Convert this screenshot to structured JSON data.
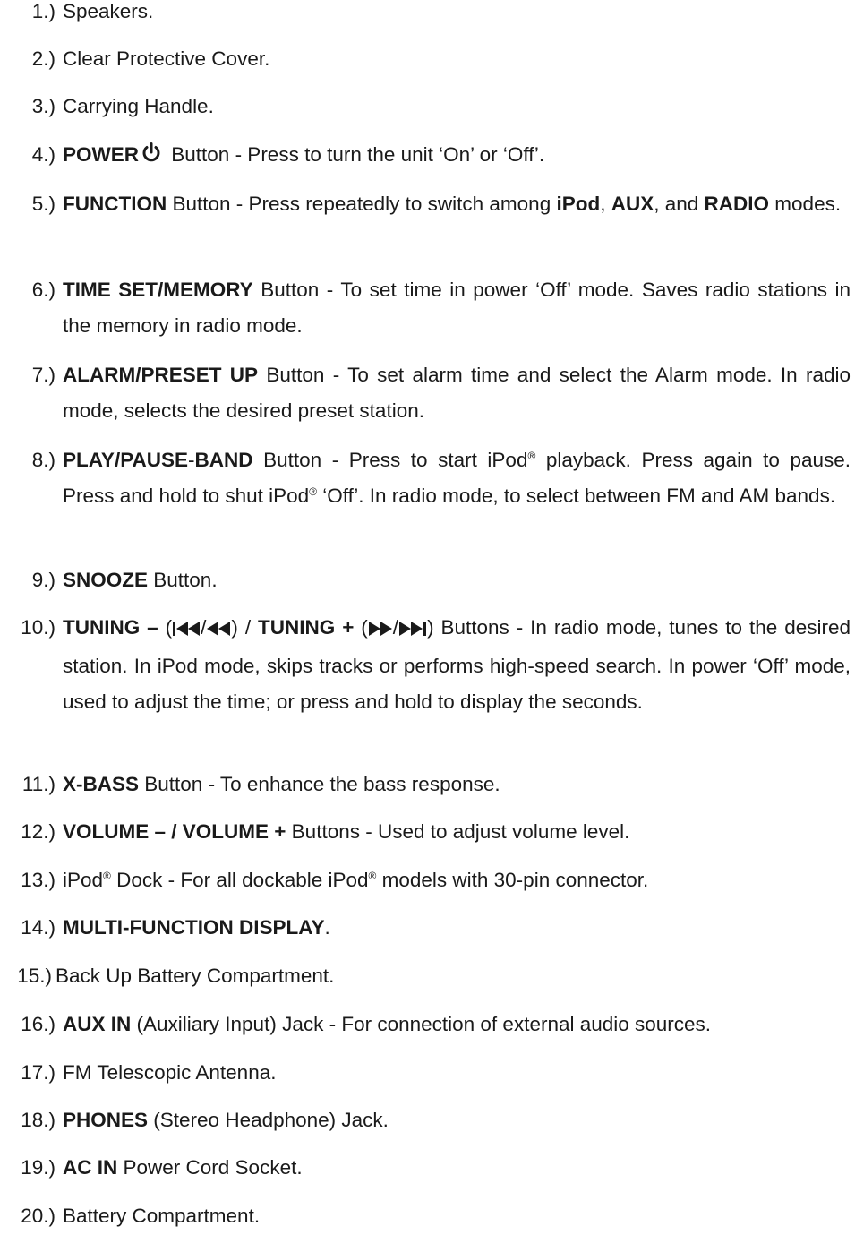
{
  "items": [
    {
      "num": "1.)",
      "runs": [
        {
          "t": "Speakers."
        }
      ]
    },
    {
      "num": "2.)",
      "runs": [
        {
          "t": "Clear Protective Cover."
        }
      ]
    },
    {
      "num": "3.)",
      "runs": [
        {
          "t": "Carrying Handle."
        }
      ]
    },
    {
      "num": "4.)",
      "runs": [
        {
          "t": "POWER",
          "b": true
        },
        {
          "icon": "power-icon"
        },
        {
          "t": " Button - Press to turn the unit ‘On’ or ‘Off’."
        }
      ]
    },
    {
      "num": "5.)",
      "runs": [
        {
          "t": "FUNCTION",
          "b": true
        },
        {
          "t": " Button - Press repeatedly to switch among "
        },
        {
          "t": "iPod",
          "b": true
        },
        {
          "t": ",  "
        },
        {
          "t": "AUX",
          "b": true
        },
        {
          "t": ", and "
        },
        {
          "t": "RADIO",
          "b": true
        },
        {
          "t": " modes."
        }
      ]
    },
    {
      "num": "6.)",
      "runs": [
        {
          "t": "TIME SET/MEMORY",
          "b": true
        },
        {
          "t": " Button - To set time in power ‘Off’ mode. Saves radio stations in the memory in radio mode."
        }
      ]
    },
    {
      "num": "7.)",
      "runs": [
        {
          "t": "ALARM/PRESET UP",
          "b": true
        },
        {
          "t": " Button - To set alarm time and select the Alarm mode. In radio mode, selects the desired preset station."
        }
      ]
    },
    {
      "num": "8.)",
      "runs": [
        {
          "t": "PLAY/PAUSE",
          "b": true
        },
        {
          "t": "-"
        },
        {
          "t": "BAND",
          "b": true
        },
        {
          "t": " Button - Press to start iPod"
        },
        {
          "sup": "®"
        },
        {
          "t": " playback. Press again to pause. Press and hold to shut iPod"
        },
        {
          "sup": "®"
        },
        {
          "t": " ‘Off’. In radio mode, to select between FM and AM bands."
        }
      ]
    },
    {
      "num": "9.)",
      "runs": [
        {
          "t": "SNOOZE",
          "b": true
        },
        {
          "t": " Button."
        }
      ]
    },
    {
      "num": "10.)",
      "runs": [
        {
          "t": "TUNING –",
          "b": true
        },
        {
          "t": " ("
        },
        {
          "icon": "skip-back-icon"
        },
        {
          "t": "/"
        },
        {
          "icon": "rewind-icon"
        },
        {
          "t": ") / "
        },
        {
          "t": "TUNING +",
          "b": true
        },
        {
          "t": " ("
        },
        {
          "icon": "fast-forward-icon"
        },
        {
          "t": "/"
        },
        {
          "icon": "skip-forward-icon"
        },
        {
          "t": ") Buttons - In radio mode, tunes to the desired station. In iPod mode, skips tracks or performs high-speed search. In power ‘Off’ mode, used to adjust the time; or press and hold to display the seconds."
        }
      ]
    },
    {
      "num": "11.)",
      "runs": [
        {
          "t": "X-BASS",
          "b": true
        },
        {
          "t": " Button - To enhance the bass response."
        }
      ]
    },
    {
      "num": "12.)",
      "runs": [
        {
          "t": "VOLUME – / VOLUME +",
          "b": true
        },
        {
          "t": " Buttons - Used to adjust volume level."
        }
      ]
    },
    {
      "num": "13.)",
      "runs": [
        {
          "t": "iPod"
        },
        {
          "sup": "®"
        },
        {
          "t": " Dock - For all dockable iPod"
        },
        {
          "sup": "®"
        },
        {
          "t": " models with 30-pin connector."
        }
      ]
    },
    {
      "num": "14.)",
      "runs": [
        {
          "t": "MULTI-FUNCTION DISPLAY",
          "b": true
        },
        {
          "t": "."
        }
      ]
    },
    {
      "num": "15.)",
      "runs": [
        {
          "t": "Back Up Battery Compartment."
        }
      ],
      "tight": true
    },
    {
      "num": "16.)",
      "runs": [
        {
          "t": "AUX IN",
          "b": true
        },
        {
          "t": " (Auxiliary Input) Jack - For connection of external audio sources."
        }
      ]
    },
    {
      "num": "17.)",
      "runs": [
        {
          "t": "FM Telescopic Antenna."
        }
      ]
    },
    {
      "num": "18.)",
      "runs": [
        {
          "t": "PHONES",
          "b": true
        },
        {
          "t": " (Stereo Headphone) Jack."
        }
      ]
    },
    {
      "num": "19.)",
      "runs": [
        {
          "t": "AC IN",
          "b": true
        },
        {
          "t": " Power Cord Socket."
        }
      ]
    },
    {
      "num": "20.)",
      "runs": [
        {
          "t": "Battery Compartment."
        }
      ]
    }
  ]
}
